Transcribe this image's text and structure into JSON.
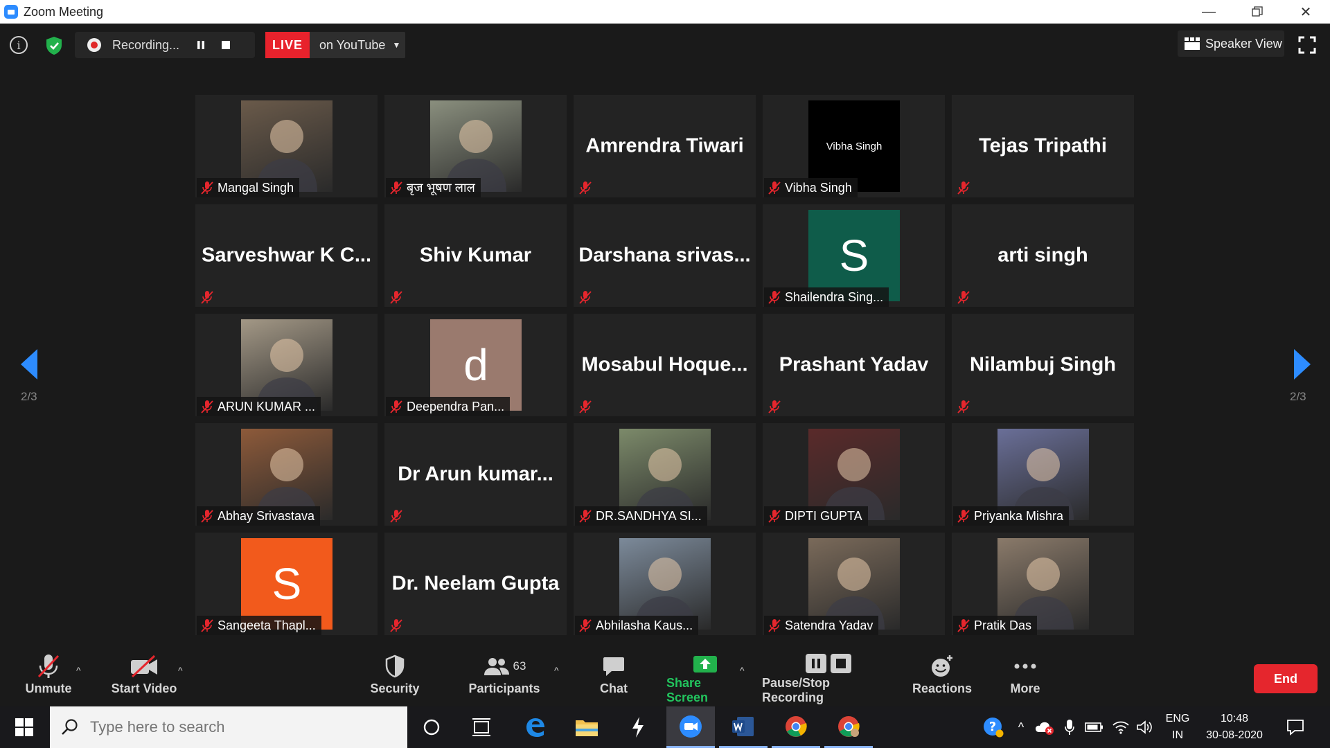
{
  "window": {
    "title": "Zoom Meeting"
  },
  "topbar": {
    "recording_label": "Recording...",
    "live_badge": "LIVE",
    "live_target": "on YouTube",
    "speaker_view": "Speaker View"
  },
  "pagination": {
    "left": "2/3",
    "right": "2/3"
  },
  "participants": [
    {
      "name": "Mangal Singh",
      "display": "photo",
      "photo_bg": "#6a5a4a"
    },
    {
      "name": "बृज भूषण लाल",
      "display": "photo",
      "photo_bg": "#8a8f7e"
    },
    {
      "name": "Amrendra Tiwari",
      "display": "name"
    },
    {
      "name": "Vibha Singh",
      "display": "text-card",
      "card_text": "Vibha Singh",
      "photo_bg": "#000000"
    },
    {
      "name": "Tejas Tripathi",
      "display": "name"
    },
    {
      "name": "Sarveshwar  K  C...",
      "display": "name"
    },
    {
      "name": "Shiv Kumar",
      "display": "name"
    },
    {
      "name": "Darshana  srivas...",
      "display": "name"
    },
    {
      "name": "Shailendra Sing...",
      "display": "letter",
      "letter": "S",
      "photo_bg": "#0f5c4a"
    },
    {
      "name": "arti singh",
      "display": "name"
    },
    {
      "name": "ARUN KUMAR ...",
      "display": "photo",
      "photo_bg": "#a39886"
    },
    {
      "name": "Deependra Pan...",
      "display": "letter",
      "letter": "d",
      "photo_bg": "#9a7a6e"
    },
    {
      "name": "Mosabul  Hoque...",
      "display": "name"
    },
    {
      "name": "Prashant Yadav",
      "display": "name"
    },
    {
      "name": "Nilambuj Singh",
      "display": "name"
    },
    {
      "name": "Abhay Srivastava",
      "display": "photo",
      "photo_bg": "#8d5a3a"
    },
    {
      "name": "Dr  Arun  kumar...",
      "display": "name"
    },
    {
      "name": "DR.SANDHYA SI...",
      "display": "photo",
      "photo_bg": "#7c8a6a"
    },
    {
      "name": "DIPTI GUPTA",
      "display": "photo",
      "photo_bg": "#5a2a2a"
    },
    {
      "name": "Priyanka Mishra",
      "display": "photo",
      "photo_bg": "#6a6f98"
    },
    {
      "name": "Sangeeta Thapl...",
      "display": "letter",
      "letter": "S",
      "photo_bg": "#f25a1c"
    },
    {
      "name": "Dr. Neelam Gupta",
      "display": "name"
    },
    {
      "name": "Abhilasha Kaus...",
      "display": "photo",
      "photo_bg": "#7c8a9a"
    },
    {
      "name": "Satendra Yadav",
      "display": "photo",
      "photo_bg": "#7a6a5a"
    },
    {
      "name": "Pratik Das",
      "display": "photo",
      "photo_bg": "#8a7a6a"
    }
  ],
  "toolbar": {
    "unmute": "Unmute",
    "start_video": "Start Video",
    "security": "Security",
    "participants": "Participants",
    "participant_count": "63",
    "chat": "Chat",
    "share_screen": "Share Screen",
    "pause_stop": "Pause/Stop Recording",
    "reactions": "Reactions",
    "more": "More",
    "end": "End"
  },
  "taskbar": {
    "search_placeholder": "Type here to search",
    "lang_top": "ENG",
    "lang_bottom": "IN",
    "time": "10:48",
    "date": "30-08-2020"
  },
  "colors": {
    "live": "#e8222c",
    "end": "#e5262d",
    "share": "#22b14c",
    "accent": "#2d8cff"
  }
}
